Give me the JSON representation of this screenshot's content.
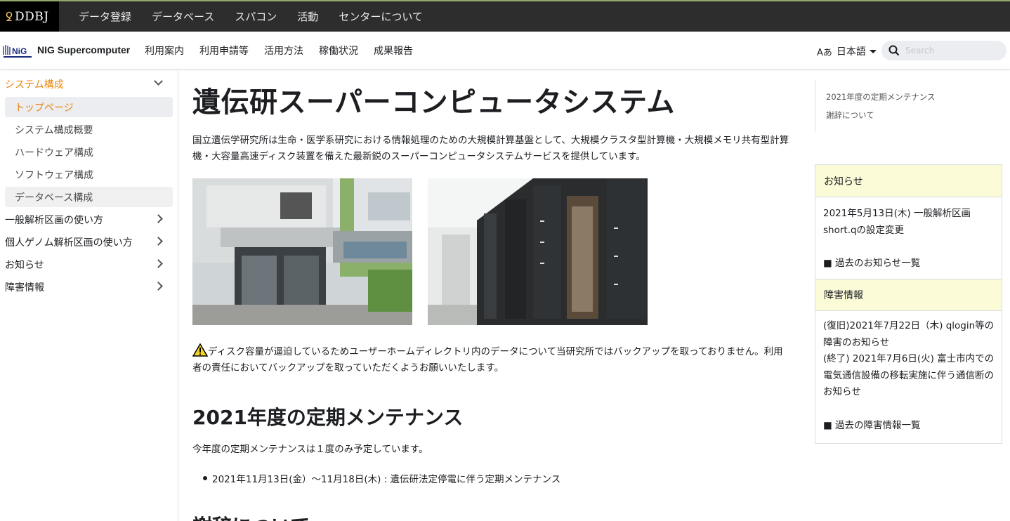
{
  "topbar": {
    "logo": "DDBJ",
    "nav": [
      "データ登録",
      "データベース",
      "スパコン",
      "活動",
      "センターについて"
    ]
  },
  "navbar": {
    "brand": "NIG Supercomputer",
    "items": [
      "利用案内",
      "利用申請等",
      "活用方法",
      "稼働状況",
      "成果報告"
    ],
    "lang_icon": "Aあ",
    "lang": "日本語",
    "search_placeholder": "Search"
  },
  "sidebar": {
    "section": "システム構成",
    "subitems": [
      "トップページ",
      "システム構成概要",
      "ハードウェア構成",
      "ソフトウェア構成",
      "データベース構成"
    ],
    "items": [
      "一般解析区画の使い方",
      "個人ゲノム解析区画の使い方",
      "お知らせ",
      "障害情報"
    ]
  },
  "main": {
    "title": "遺伝研スーパーコンピュータシステム",
    "intro": "国立遺伝学研究所は生命・医学系研究における情報処理のための大規模計算基盤として、大規模クラスタ型計算機・大規模メモリ共有型計算機・大容量高速ディスク装置を備えた最新鋭のスーパーコンピュータシステムサービスを提供しています。",
    "warning": "ディスク容量が逼迫しているためユーザーホームディレクトリ内のデータについて当研究所ではバックアップを取っておりません。利用者の責任においてバックアップを取っていただくようお願いいたします。",
    "section_title": "2021年度の定期メンテナンス",
    "section_text": "今年度の定期メンテナンスは１度のみ予定しています。",
    "bullet": "2021年11月13日(金）〜11月18日(木) : 遺伝研法定停電に伴う定期メンテナンス",
    "section2_title": "謝辞について"
  },
  "toc": [
    "2021年度の定期メンテナンス",
    "謝辞について"
  ],
  "news": {
    "title": "お知らせ",
    "item": "2021年5月13日(木) 一般解析区画short.qの設定変更",
    "more": "■ 過去のお知らせ一覧"
  },
  "incidents": {
    "title": "障害情報",
    "item1": "(復旧)2021年7月22日（木) qlogin等の障害のお知らせ",
    "item2": "(終了) 2021年7月6日(火) 富士市内での電気通信設備の移転実施に伴う通信断のお知らせ",
    "more": "■ 過去の障害情報一覧"
  }
}
